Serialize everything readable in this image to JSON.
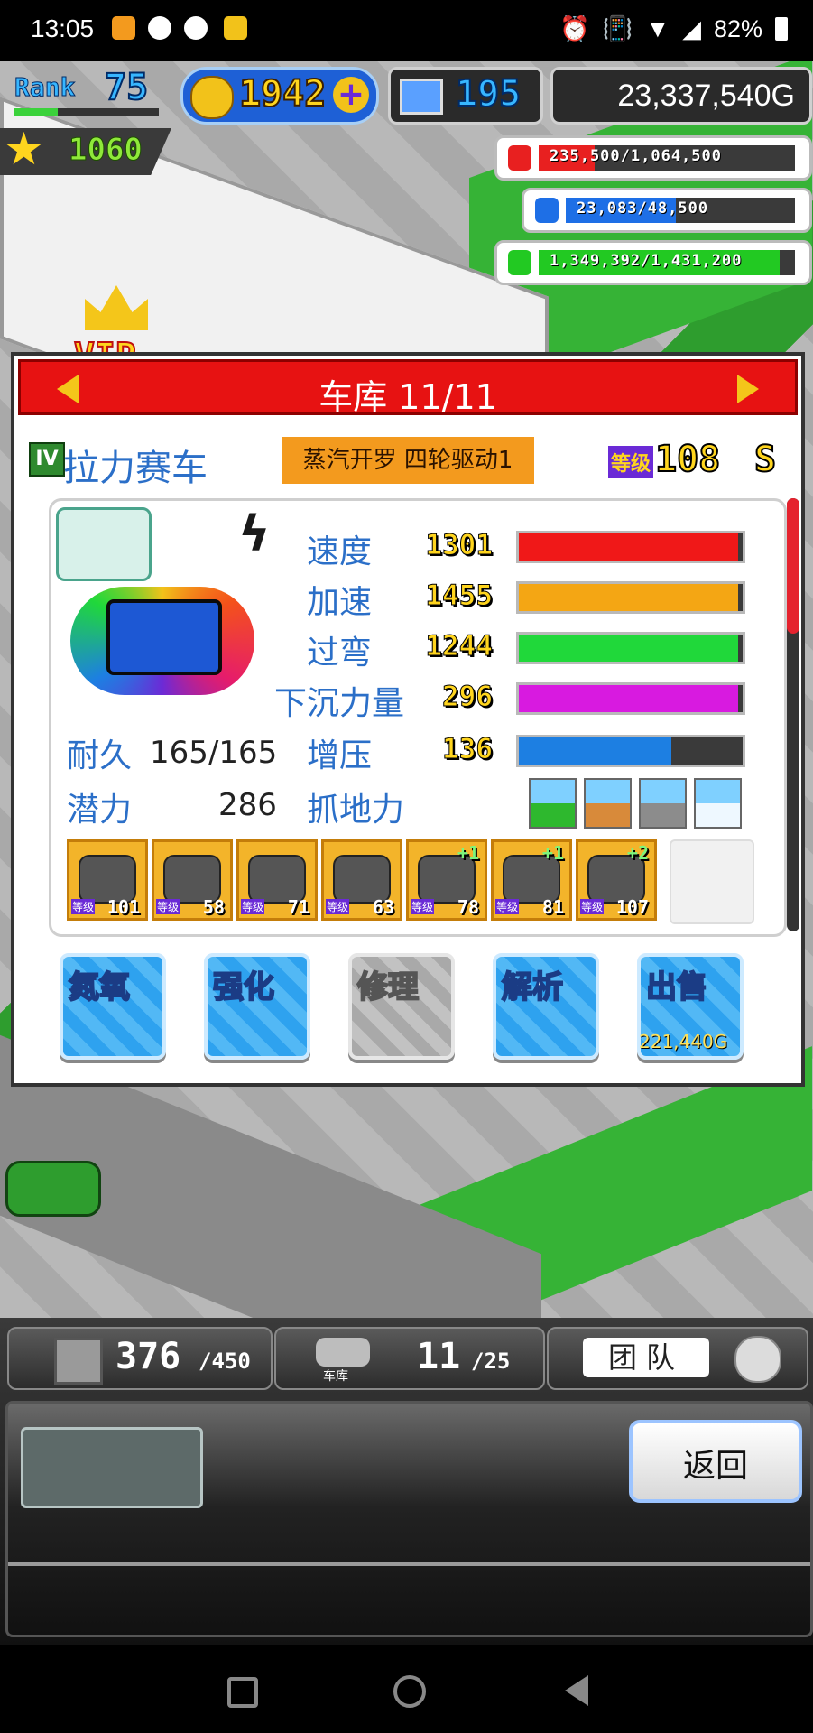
{
  "status_bar": {
    "time": "13:05",
    "battery": "82%"
  },
  "hud": {
    "rank_label": "Rank",
    "rank_value": "75",
    "gp_value": "1942",
    "computer_value": "195",
    "money": "23,337,540G",
    "stars": "1060",
    "vip_label": "VIP"
  },
  "resources": [
    {
      "name": "coins-icon",
      "text": "235,500/1,064,500",
      "fraction": 0.22,
      "color": "#e82020"
    },
    {
      "name": "fuel-icon",
      "text": "23,083/48,500",
      "fraction": 0.48,
      "color": "#1e6fe6"
    },
    {
      "name": "wheat-icon",
      "text": "1,349,392/1,431,200",
      "fraction": 0.94,
      "color": "#22c922"
    }
  ],
  "panel": {
    "title": "车库 11/11",
    "rank_badge": "IV",
    "car_class": "拉力赛车",
    "car_name": "蒸汽开罗 四轮驱动1",
    "level_label": "等级",
    "level": "108",
    "grade": "S",
    "stats": [
      {
        "label": "速度",
        "value": "1301",
        "fraction": 0.98,
        "color": "#f01818"
      },
      {
        "label": "加速",
        "value": "1455",
        "fraction": 0.98,
        "color": "#f4a614"
      },
      {
        "label": "过弯",
        "value": "1244",
        "fraction": 0.98,
        "color": "#20d83a"
      },
      {
        "label": "下沉力量",
        "value": "296",
        "fraction": 0.98,
        "color": "#d81ae0"
      },
      {
        "label": "增压",
        "value": "136",
        "fraction": 0.68,
        "color": "#1d7fe2"
      }
    ],
    "durability_label": "耐久",
    "durability": "165/165",
    "potential_label": "潜力",
    "potential": "286",
    "grip_label": "抓地力",
    "parts": [
      {
        "level": "101",
        "plus": "",
        "name": "part-engine"
      },
      {
        "level": "58",
        "plus": "",
        "name": "part-tire"
      },
      {
        "level": "71",
        "plus": "",
        "name": "part-wheel"
      },
      {
        "level": "63",
        "plus": "",
        "name": "part-turbo"
      },
      {
        "level": "78",
        "plus": "+1",
        "name": "part-supercharger"
      },
      {
        "level": "81",
        "plus": "+1",
        "name": "part-exhaust"
      },
      {
        "level": "107",
        "plus": "+2",
        "name": "part-wing"
      }
    ],
    "part_level_label": "等级",
    "actions": [
      {
        "label": "氮氧",
        "name": "nitro-button",
        "disabled": false
      },
      {
        "label": "强化",
        "name": "enhance-button",
        "disabled": false
      },
      {
        "label": "修理",
        "name": "repair-button",
        "disabled": true
      },
      {
        "label": "解析",
        "name": "analyze-button",
        "disabled": false
      },
      {
        "label": "出售",
        "name": "sell-button",
        "disabled": false
      }
    ],
    "sell_price": "221,440G"
  },
  "bottom": {
    "items_count": "376",
    "items_max": "/450",
    "garage_label": "车库",
    "garage_count": "11",
    "garage_max": "/25",
    "team_label": "团队",
    "back_label": "返回"
  },
  "colors": {
    "header_red": "#e71212",
    "name_tag": "#f39a1e",
    "stat_label_blue": "#2b6fc8"
  }
}
